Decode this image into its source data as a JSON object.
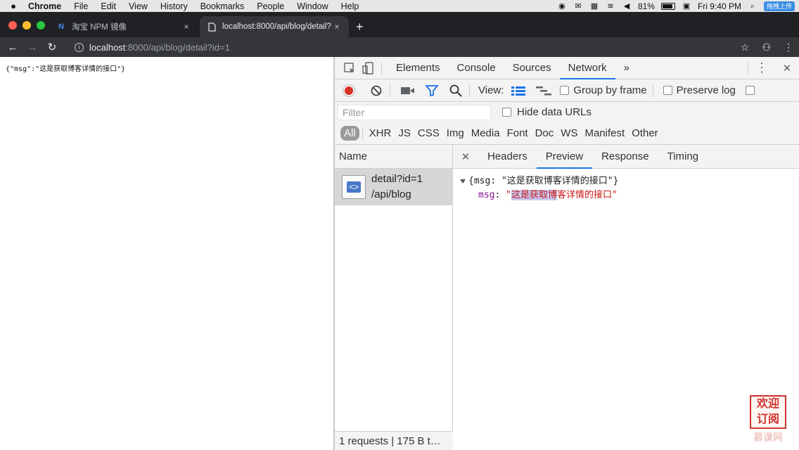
{
  "menubar": {
    "apple": "",
    "items": [
      "Chrome",
      "File",
      "Edit",
      "View",
      "History",
      "Bookmarks",
      "People",
      "Window",
      "Help"
    ],
    "battery": "81%",
    "clock": "Fri 9:40 PM",
    "badge": "拖拽上传"
  },
  "tabs": {
    "inactive_favicon": "N",
    "inactive_title": "淘宝 NPM 镜像",
    "active_title": "localhost:8000/api/blog/detail?",
    "close": "×",
    "new_tab": "+"
  },
  "toolbar": {
    "back": "←",
    "forward": "→",
    "reload": "↻",
    "url_host": "localhost",
    "url_rest": ":8000/api/blog/detail?id=1",
    "star": "☆",
    "menu": "⋮"
  },
  "page": {
    "json_text": "{\"msg\":\"这是获取博客详情的接口\"}"
  },
  "devtools": {
    "tabs": [
      "Elements",
      "Console",
      "Sources",
      "Network"
    ],
    "active_tab": "Network",
    "more": "»",
    "kebab": "⋮",
    "close": "✕",
    "view_label": "View:",
    "group_by_frame": "Group by frame",
    "preserve_log": "Preserve log",
    "filter_placeholder": "Filter",
    "hide_data_urls": "Hide data URLs",
    "types": [
      "All",
      "XHR",
      "JS",
      "CSS",
      "Img",
      "Media",
      "Font",
      "Doc",
      "WS",
      "Manifest",
      "Other"
    ],
    "name_header": "Name",
    "request": {
      "name": "detail?id=1",
      "path": "/api/blog",
      "icon_label": "<>"
    },
    "status": "1 requests | 175 B t…",
    "detail_tabs": [
      "Headers",
      "Preview",
      "Response",
      "Timing"
    ],
    "active_detail_tab": "Preview",
    "preview": {
      "summary": "{msg: \"这是获取博客详情的接口\"}",
      "key": "msg",
      "value_highlighted": "这是获取博",
      "value_rest": "客详情的接口"
    }
  },
  "watermark": {
    "line1": "欢迎",
    "line2": "订阅",
    "brand": "慕课网"
  }
}
